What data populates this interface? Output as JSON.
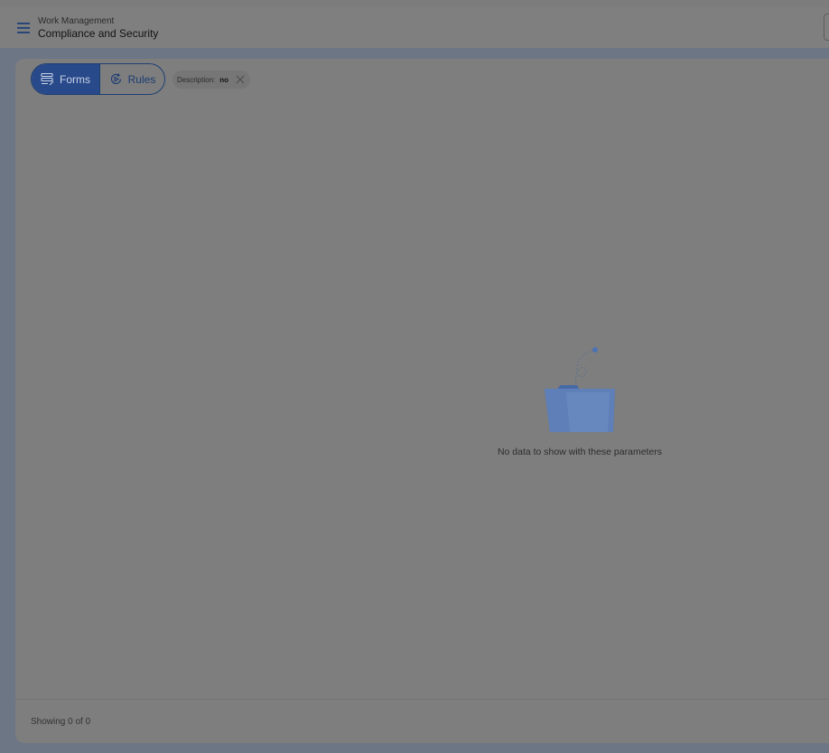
{
  "header": {
    "breadcrumb_parent": "Work Management",
    "title": "Compliance and Security"
  },
  "view_toggle": {
    "forms_label": "Forms",
    "rules_label": "Rules",
    "active": "Forms"
  },
  "filter_chip": {
    "key": "Description:",
    "value": "no"
  },
  "empty_state": {
    "message": "No data to show with these parameters"
  },
  "footer": {
    "showing_text": "Showing 0 of 0"
  },
  "icons": {
    "menu": "hamburger-menu-icon",
    "forms": "form-list-icon",
    "rules": "rules-refresh-icon",
    "clear": "close-icon",
    "empty": "empty-folder-illustration"
  },
  "colors": {
    "accent": "#28498a",
    "overlay_bg": "#7c7c7c",
    "frame": "#6c7684"
  }
}
